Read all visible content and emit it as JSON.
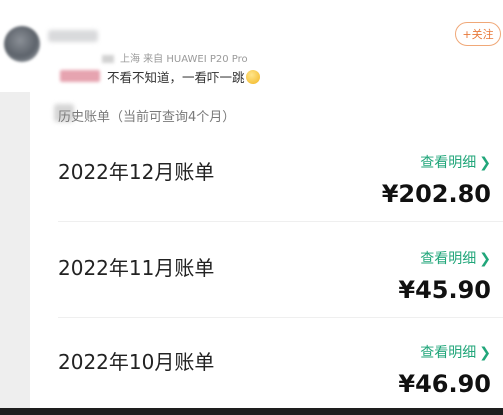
{
  "post": {
    "meta": "上海 来自 HUAWEI P20 Pro",
    "follow_label": "+关注",
    "caption": "不看不知道，一看吓一跳"
  },
  "screenshot": {
    "section_title": "历史账单（当前可查询4个月）",
    "detail_label": "查看明细",
    "bills": [
      {
        "month": "2022年12月账单",
        "amount": "¥202.80"
      },
      {
        "month": "2022年11月账单",
        "amount": "¥45.90"
      },
      {
        "month": "2022年10月账单",
        "amount": "¥46.90"
      }
    ]
  },
  "colors": {
    "accent_green": "#21a67a",
    "follow_orange": "#e8793a"
  }
}
